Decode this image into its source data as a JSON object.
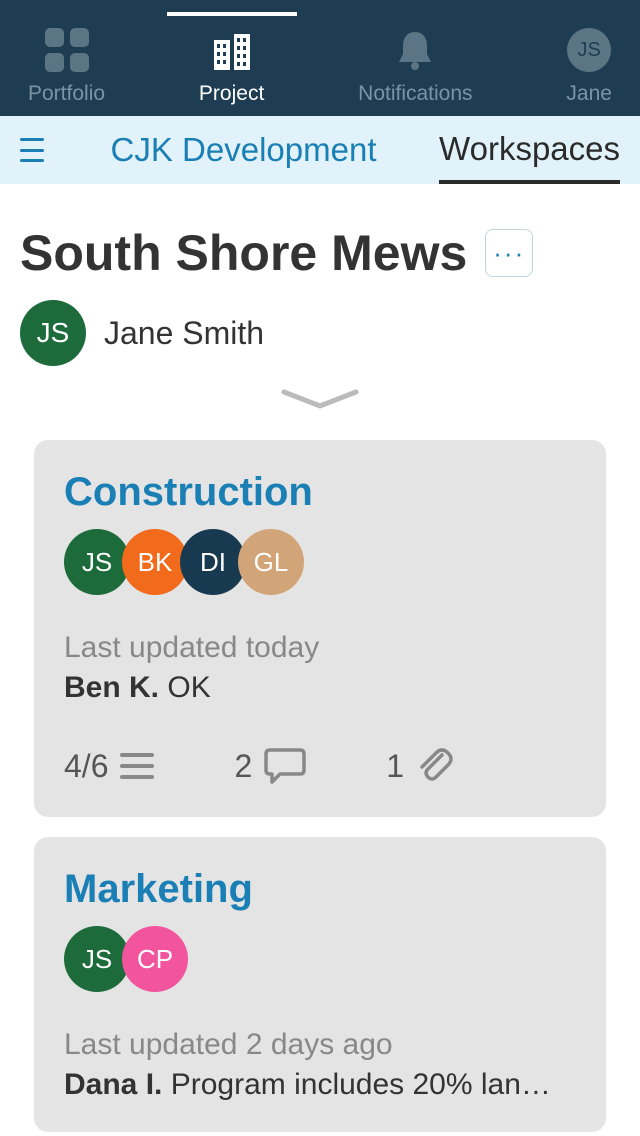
{
  "nav": {
    "items": [
      {
        "label": "Portfolio"
      },
      {
        "label": "Project"
      },
      {
        "label": "Notifications"
      },
      {
        "label": "Jane"
      }
    ],
    "user_initials": "JS"
  },
  "subnav": {
    "title": "CJK Development",
    "tab": "Workspaces"
  },
  "project": {
    "title": "South Shore Mews",
    "owner_initials": "JS",
    "owner_name": "Jane Smith",
    "more_label": "···"
  },
  "workspaces": [
    {
      "title": "Construction",
      "members": [
        {
          "initials": "JS",
          "color": "c-green"
        },
        {
          "initials": "BK",
          "color": "c-orange"
        },
        {
          "initials": "DI",
          "color": "c-navy"
        },
        {
          "initials": "GL",
          "color": "c-tan"
        }
      ],
      "updated": "Last updated today",
      "last_author": "Ben K.",
      "last_msg": "OK",
      "tasks": "4/6",
      "comments": "2",
      "attachments": "1"
    },
    {
      "title": "Marketing",
      "members": [
        {
          "initials": "JS",
          "color": "c-green"
        },
        {
          "initials": "CP",
          "color": "c-pink"
        }
      ],
      "updated": "Last updated 2 days ago",
      "last_author": "Dana I.",
      "last_msg": "Program includes 20% lan…"
    }
  ]
}
